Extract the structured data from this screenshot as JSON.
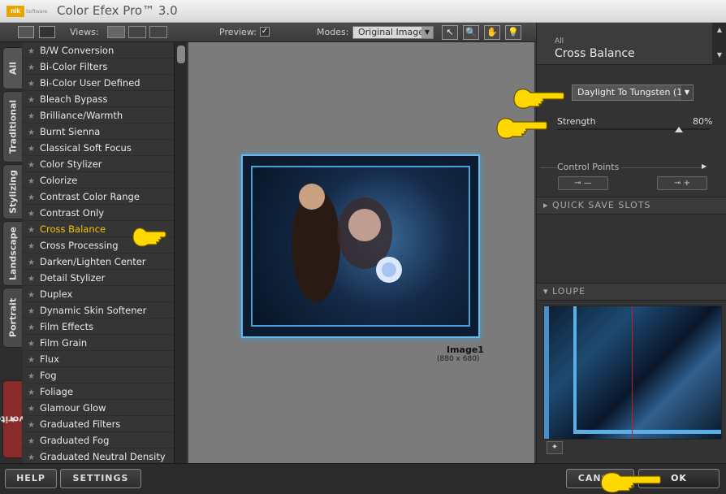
{
  "window": {
    "logo_text": "nik",
    "logo_sub": "Software",
    "title": "Color Efex Pro™ 3.0"
  },
  "toolbar": {
    "views_label": "Views:",
    "preview_label": "Preview:",
    "preview_checked": "✓",
    "modes_label": "Modes:",
    "mode_value": "Original Image"
  },
  "tabs": [
    "All",
    "Traditional",
    "Stylizing",
    "Landscape",
    "Portrait",
    "Favorites"
  ],
  "filters": [
    "B/W Conversion",
    "Bi-Color Filters",
    "Bi-Color User Defined",
    "Bleach Bypass",
    "Brilliance/Warmth",
    "Burnt Sienna",
    "Classical Soft Focus",
    "Color Stylizer",
    "Colorize",
    "Contrast Color Range",
    "Contrast Only",
    "Cross Balance",
    "Cross Processing",
    "Darken/Lighten Center",
    "Detail Stylizer",
    "Duplex",
    "Dynamic Skin Softener",
    "Film Effects",
    "Film Grain",
    "Flux",
    "Fog",
    "Foliage",
    "Glamour Glow",
    "Graduated Filters",
    "Graduated Fog",
    "Graduated Neutral Density"
  ],
  "selected_filter_index": 11,
  "preview": {
    "image_name": "Image1",
    "image_size": "(880 x 680)"
  },
  "panel": {
    "category": "All",
    "title": "Cross Balance",
    "preset": "Daylight To Tungsten (1)",
    "strength_label": "Strength",
    "strength_value": "80%",
    "strength_fraction": 0.8,
    "control_points_label": "Control Points",
    "quick_save_label": "QUICK SAVE SLOTS",
    "loupe_label": "LOUPE"
  },
  "buttons": {
    "help": "HELP",
    "settings": "SETTINGS",
    "cancel": "CANCEL",
    "ok": "OK"
  },
  "colors": {
    "accent_selected": "#f5c400",
    "pointer_yellow": "#ffd800"
  }
}
